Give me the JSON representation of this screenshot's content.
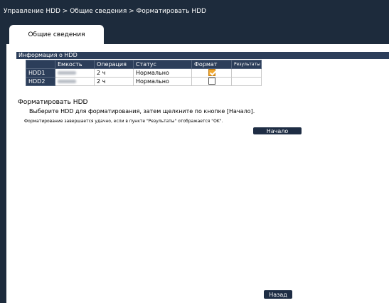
{
  "breadcrumb": "Управление HDD > Общие сведения > Форматировать HDD",
  "tab": {
    "label": "Общие сведения"
  },
  "hdd_info": {
    "title": "Информация о HDD",
    "columns": [
      "",
      "Емкость",
      "Операция",
      "Статус",
      "Формат",
      "Результаты"
    ],
    "rows": [
      {
        "name": "HDD1",
        "operation": "2 ч",
        "status": "Нормально",
        "format_checked": true,
        "result": ""
      },
      {
        "name": "HDD2",
        "operation": "2 ч",
        "status": "Нормально",
        "format_checked": false,
        "result": ""
      }
    ]
  },
  "format_section": {
    "title": "Форматировать HDD",
    "instruction": "Выберите HDD для форматирования, затем щелкните по кнопке [Начало].",
    "note": "Форматирование завершается удачно, если в пункте \"Результаты\" отображается \"OK\".",
    "start_button": "Начало"
  },
  "back_button": "Назад",
  "colors": {
    "header_bg": "#2c3e5a",
    "frame_bg": "#1d2b3c",
    "checkbox_checked": "#f0a830"
  }
}
